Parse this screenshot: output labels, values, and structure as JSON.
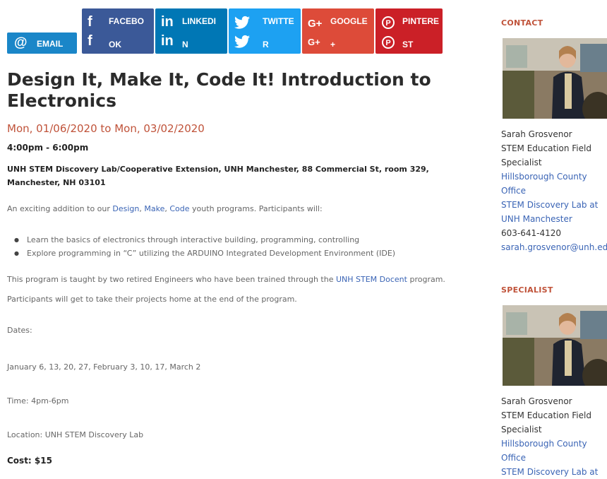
{
  "share": {
    "email": {
      "icon": "@",
      "label": "EMAIL"
    },
    "facebook": {
      "icon": "f",
      "line1": "FACEBO",
      "line2": "OK"
    },
    "linkedin": {
      "icon": "in",
      "line1": "LINKEDI",
      "line2": "N"
    },
    "twitter": {
      "icon": "♥",
      "line1": "TWITTE",
      "line2": "R"
    },
    "google": {
      "icon": "G+",
      "line1": "GOOGLE",
      "line2": "+"
    },
    "pinterest": {
      "icon": "℗",
      "line1": "PINTERE",
      "line2": "ST"
    },
    "colors": {
      "email": "#1a86c8",
      "facebook": "#3b5998",
      "linkedin": "#0077b5",
      "twitter": "#1da1f2",
      "google": "#dd4b39",
      "pinterest": "#cb2027"
    }
  },
  "event": {
    "title": "Design It, Make It, Code It! Introduction to Electronics",
    "date": "Mon, 01/06/2020 to Mon, 03/02/2020",
    "time": "4:00pm - 6:00pm",
    "location": "UNH STEM Discovery Lab/Cooperative Extension,  UNH Manchester,  88 Commercial St, room 329, Manchester, NH 03101",
    "intro_before": "An exciting addition to our ",
    "intro_links": [
      "Design",
      "Make",
      "Code"
    ],
    "intro_after": " youth programs.  Participants will:",
    "bullets": [
      "Learn the basics of electronics through interactive building, programming, controlling",
      "Explore programming in “C” utilizing the ARDUINO Integrated Development Environment (IDE)"
    ],
    "taught_before": "This program is taught by two retired Engineers who have been trained through the ",
    "taught_link": "UNH STEM Docent",
    "taught_after": " program.",
    "takehome": "Participants will get to take their projects home at the end of the program.",
    "dates_label": "Dates:",
    "dates_list": "January 6, 13, 20, 27, February 3, 10, 17, March 2",
    "time_line": "Time: 4pm-6pm",
    "location_line": "Location:  UNH STEM Discovery Lab",
    "cost": "Cost: $15"
  },
  "sidebar": {
    "contact_heading": "CONTACT",
    "specialist_heading": "SPECIALIST",
    "person": {
      "name": "Sarah Grosvenor",
      "title1": "STEM Education Field",
      "title2": "Specialist",
      "office1": "Hillsborough County",
      "office2": "Office",
      "lab1": "STEM Discovery Lab at",
      "lab2": "UNH Manchester",
      "phone": "603-641-4120",
      "email": "sarah.grosvenor@unh.edu"
    }
  }
}
